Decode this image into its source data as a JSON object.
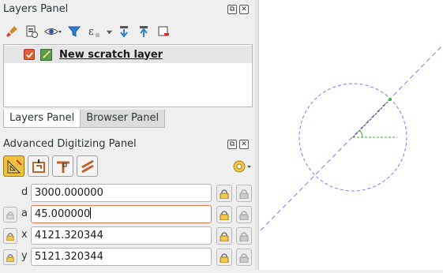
{
  "layers_panel": {
    "title": "Layers Panel",
    "toolbar_icons": [
      "paint-brush-icon",
      "add-group-icon",
      "eye-icon",
      "filter-icon",
      "expression-filter-icon",
      "expand-all-icon",
      "collapse-all-icon",
      "remove-layer-icon"
    ],
    "layers": [
      {
        "name": "New scratch layer",
        "checked": true,
        "icon": "line-layer-icon"
      }
    ],
    "tabs": [
      {
        "label": "Layers Panel",
        "active": true
      },
      {
        "label": "Browser Panel",
        "active": false
      }
    ]
  },
  "advanced_digitizing": {
    "title": "Advanced Digitizing Panel",
    "tool_buttons": [
      "enable-advanced-digitizing-icon",
      "construction-mode-icon",
      "perpendicular-icon",
      "parallel-icon"
    ],
    "fields": [
      {
        "label": "d",
        "value": "3000.000000",
        "left_lock": false
      },
      {
        "label": "a",
        "value": "45.000000",
        "left_lock": true,
        "focused": true
      },
      {
        "label": "x",
        "value": "4121.320344",
        "left_lock": true
      },
      {
        "label": "y",
        "value": "5121.320344",
        "left_lock": true
      }
    ]
  },
  "colors": {
    "accent_orange": "#e07a4a",
    "guide_blue": "#7b7bf0",
    "snap_green": "#3cb043"
  }
}
